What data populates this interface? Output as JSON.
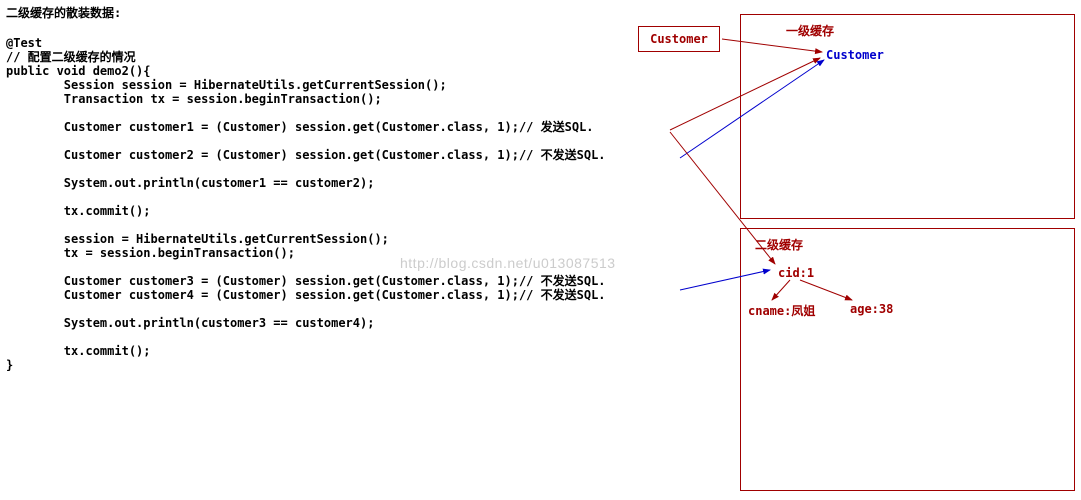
{
  "title": "二级缓存的散装数据:",
  "code": "@Test\n// 配置二级缓存的情况\npublic void demo2(){\n        Session session = HibernateUtils.getCurrentSession();\n        Transaction tx = session.beginTransaction();\n\n        Customer customer1 = (Customer) session.get(Customer.class, 1);// 发送SQL.\n\n        Customer customer2 = (Customer) session.get(Customer.class, 1);// 不发送SQL.\n\n        System.out.println(customer1 == customer2);\n\n        tx.commit();\n\n        session = HibernateUtils.getCurrentSession();\n        tx = session.beginTransaction();\n\n        Customer customer3 = (Customer) session.get(Customer.class, 1);// 不发送SQL.\n        Customer customer4 = (Customer) session.get(Customer.class, 1);// 不发送SQL.\n\n        System.out.println(customer3 == customer4);\n\n        tx.commit();\n}",
  "boxes": {
    "customer_label": "Customer",
    "level1_cache": "一级缓存",
    "level2_cache": "二级缓存",
    "level1_customer": "Customer",
    "cid": "cid:1",
    "cname": "cname:凤姐",
    "age": "age:38"
  },
  "watermark": "http://blog.csdn.net/u013087513"
}
